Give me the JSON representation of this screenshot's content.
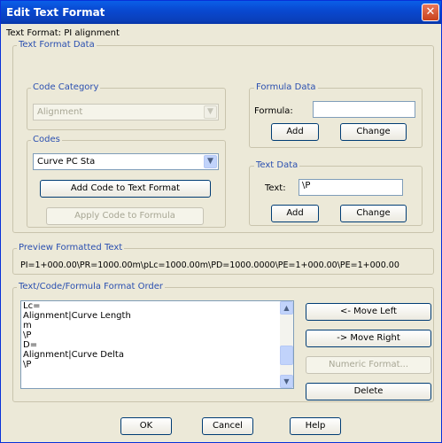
{
  "window": {
    "title": "Edit Text Format",
    "close_glyph": "✕"
  },
  "text_format": {
    "label": "Text Format:",
    "value": "PI alignment"
  },
  "text_format_data": {
    "legend": "Text Format Data"
  },
  "code_category": {
    "legend": "Code Category",
    "selected": "Alignment",
    "arrow_icon": "chevron-down-icon"
  },
  "codes": {
    "legend": "Codes",
    "selected": "Curve PC Sta",
    "add_code_button": "Add Code to Text Format",
    "apply_code_button": "Apply Code to Formula"
  },
  "formula_data": {
    "legend": "Formula Data",
    "formula_label": "Formula:",
    "formula_value": "",
    "add_button": "Add",
    "change_button": "Change"
  },
  "text_data": {
    "legend": "Text Data",
    "text_label": "Text:",
    "text_value": "\\P",
    "add_button": "Add",
    "change_button": "Change"
  },
  "preview": {
    "legend": "Preview Formatted Text",
    "text": "PI=1+000.00\\PR=1000.00m\\pLc=1000.00m\\PD=1000.0000\\PE=1+000.00\\PE=1+000.00"
  },
  "format_order": {
    "legend": "Text/Code/Formula Format Order",
    "items": [
      "Lc=",
      "Alignment|Curve Length",
      "m",
      "\\P",
      "D=",
      "Alignment|Curve Delta",
      "\\P"
    ],
    "move_left_button": "<- Move Left",
    "move_right_button": "-> Move Right",
    "numeric_format_button": "Numeric Format...",
    "delete_button": "Delete"
  },
  "footer": {
    "ok_button": "OK",
    "cancel_button": "Cancel",
    "help_button": "Help"
  },
  "colors": {
    "title_bar": "#0a4fd6",
    "legend_text": "#2a4fb0",
    "dialog_bg": "#ece9d8",
    "disabled_text": "#a7a694"
  }
}
